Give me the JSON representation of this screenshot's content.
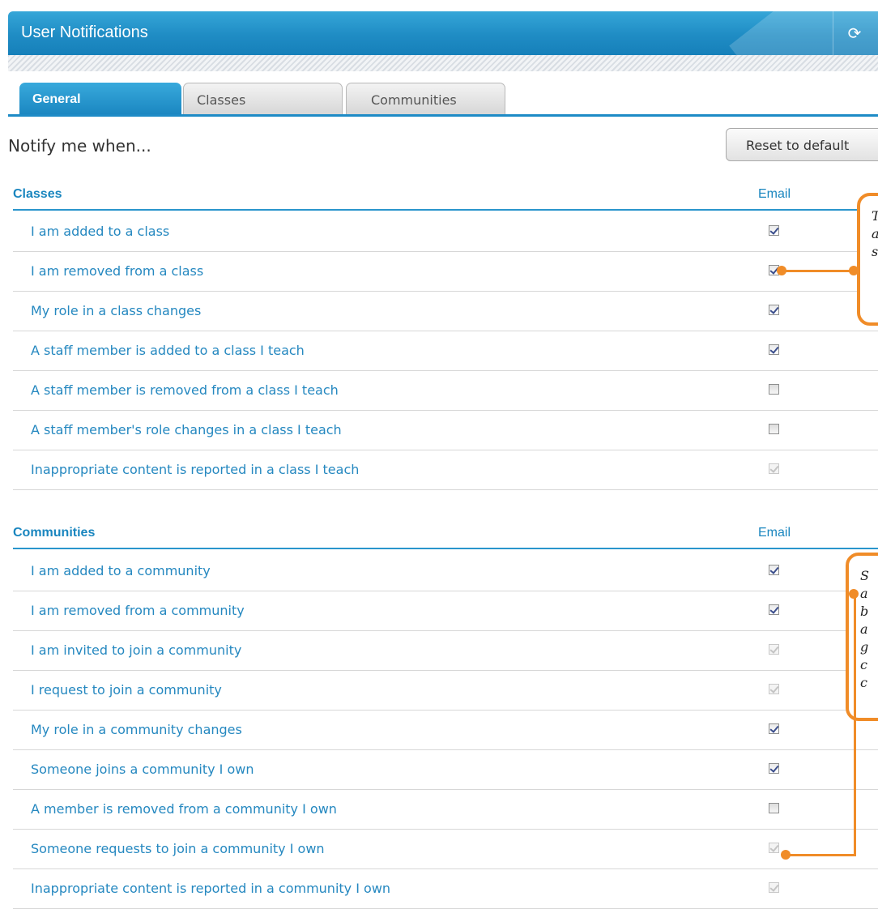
{
  "header": {
    "title": "User Notifications",
    "refresh_icon": "refresh-icon"
  },
  "tabs": [
    {
      "label": "General",
      "active": true
    },
    {
      "label": "Classes",
      "active": false
    },
    {
      "label": "Communities",
      "active": false
    }
  ],
  "notify_heading": "Notify me when...",
  "reset_button": "Reset to default",
  "sections": [
    {
      "name": "Classes",
      "column": "Email",
      "rows": [
        {
          "label": "I am added to a class",
          "state": "checked"
        },
        {
          "label": "I am removed from a class",
          "state": "checked"
        },
        {
          "label": "My role in a class changes",
          "state": "checked"
        },
        {
          "label": "A staff member is added to a class I teach",
          "state": "checked"
        },
        {
          "label": "A staff member is removed from a class I teach",
          "state": "unchecked"
        },
        {
          "label": "A staff member's role changes in a class I teach",
          "state": "unchecked"
        },
        {
          "label": "Inappropriate content is reported in a class I teach",
          "state": "disabled"
        }
      ]
    },
    {
      "name": "Communities",
      "column": "Email",
      "rows": [
        {
          "label": "I am added to a community",
          "state": "checked"
        },
        {
          "label": "I am removed from a community",
          "state": "checked"
        },
        {
          "label": "I am invited to join a community",
          "state": "disabled"
        },
        {
          "label": "I request to join a community",
          "state": "disabled"
        },
        {
          "label": "My role in a community changes",
          "state": "checked"
        },
        {
          "label": "Someone joins a community I own",
          "state": "checked"
        },
        {
          "label": "A member is removed from a community I own",
          "state": "unchecked"
        },
        {
          "label": "Someone requests to join a community I own",
          "state": "disabled"
        },
        {
          "label": "Inappropriate content is reported in a community I own",
          "state": "disabled"
        }
      ]
    }
  ],
  "callouts": [
    {
      "text": "T\na\ns"
    },
    {
      "text": "S\na\nb\na\ng\nc\nc"
    }
  ],
  "colors": {
    "accent": "#1d8bc6",
    "callout": "#f08c28",
    "link": "#2588c0"
  }
}
